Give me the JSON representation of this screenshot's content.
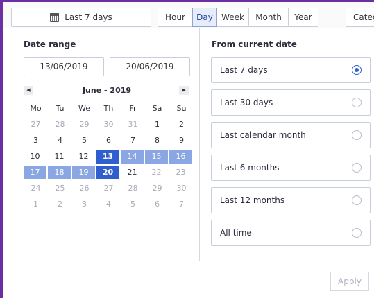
{
  "toolbar": {
    "range_button_label": "Last 7 days",
    "granularity": [
      "Hour",
      "Day",
      "Week",
      "Month",
      "Year"
    ],
    "granularity_active": "Day",
    "category_label": "Categ"
  },
  "date_range": {
    "title": "Date range",
    "start": "13/06/2019",
    "end": "20/06/2019",
    "month_label": "June - 2019",
    "prev": "◀",
    "next": "▶",
    "weekdays": [
      "Mo",
      "Tu",
      "We",
      "Th",
      "Fr",
      "Sa",
      "Su"
    ],
    "weeks": [
      [
        "27",
        "28",
        "29",
        "30",
        "31",
        "1",
        "2"
      ],
      [
        "3",
        "4",
        "5",
        "6",
        "7",
        "8",
        "9"
      ],
      [
        "10",
        "11",
        "12",
        "13",
        "14",
        "15",
        "16"
      ],
      [
        "17",
        "18",
        "19",
        "20",
        "21",
        "22",
        "23"
      ],
      [
        "24",
        "25",
        "26",
        "27",
        "28",
        "29",
        "30"
      ],
      [
        "1",
        "2",
        "3",
        "4",
        "5",
        "6",
        "7"
      ]
    ]
  },
  "presets": {
    "title": "From current date",
    "options": [
      "Last 7 days",
      "Last 30 days",
      "Last calendar month",
      "Last 6 months",
      "Last 12 months",
      "All time"
    ],
    "selected": "Last 7 days"
  },
  "footer": {
    "apply_label": "Apply"
  },
  "colors": {
    "accent": "#2f5fcf",
    "range": "#8aa6e3",
    "frame": "#6b2fa3"
  }
}
